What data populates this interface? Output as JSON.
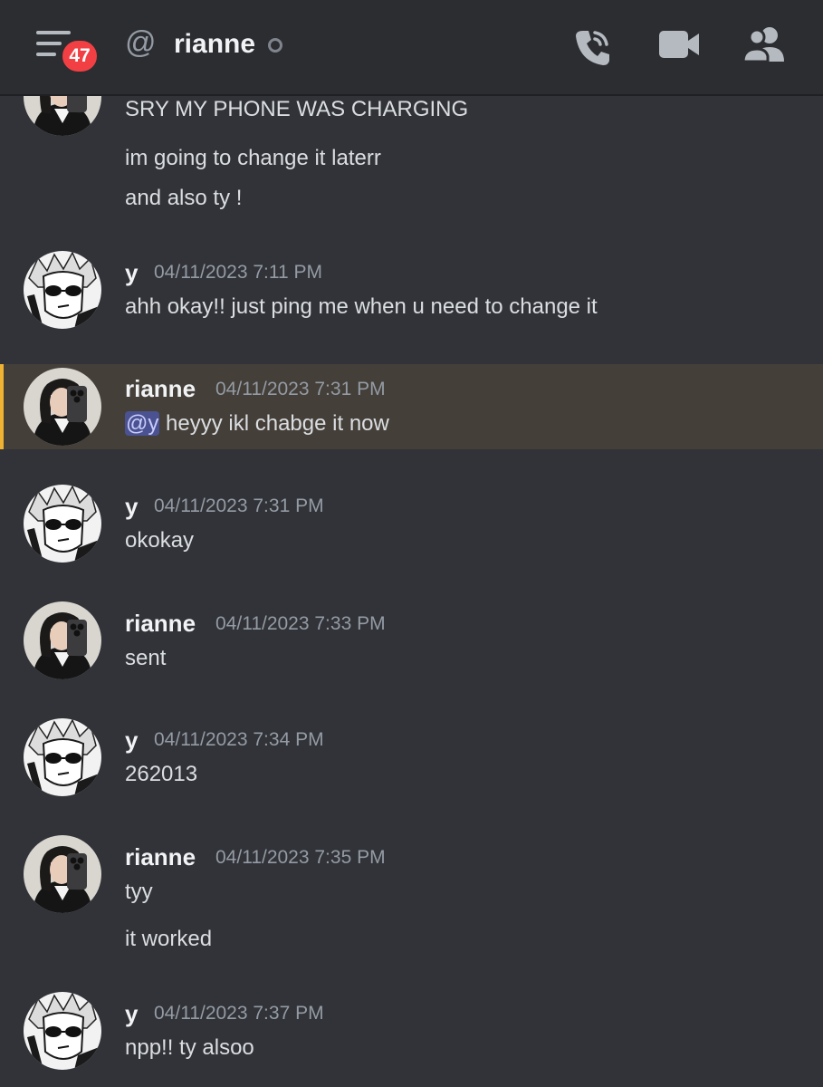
{
  "header": {
    "notification_count": "47",
    "at_symbol": "@",
    "channel_name": "rianne"
  },
  "messages": [
    {
      "lines": [
        "SRY MY PHONE WAS CHARGING",
        "im going to change it laterr",
        "and also ty !"
      ]
    },
    {
      "author": "y",
      "timestamp": "04/11/2023 7:11 PM",
      "lines": [
        "ahh okay!! just ping me when u need to change it"
      ]
    },
    {
      "author": "rianne",
      "timestamp": "04/11/2023 7:31 PM",
      "mention": "@y",
      "lines": [
        " heyyy ikl chabge it now"
      ]
    },
    {
      "author": "y",
      "timestamp": "04/11/2023 7:31 PM",
      "lines": [
        "okokay"
      ]
    },
    {
      "author": "rianne",
      "timestamp": "04/11/2023 7:33 PM",
      "lines": [
        "sent"
      ]
    },
    {
      "author": "y",
      "timestamp": "04/11/2023 7:34 PM",
      "lines": [
        "262013"
      ]
    },
    {
      "author": "rianne",
      "timestamp": "04/11/2023 7:35 PM",
      "lines": [
        "tyy",
        "it worked"
      ]
    },
    {
      "author": "y",
      "timestamp": "04/11/2023 7:37 PM",
      "lines": [
        "npp!! ty alsoo"
      ]
    }
  ],
  "colors": {
    "background": "#313338",
    "header": "#2b2d31",
    "badge": "#f23f43",
    "highlight": "#443f39",
    "highlight_accent": "#f0b232",
    "mention_bg": "#4b5291"
  },
  "icons": [
    "menu-icon",
    "at-icon",
    "status-idle-icon",
    "phone-call-icon",
    "video-camera-icon",
    "members-icon"
  ]
}
